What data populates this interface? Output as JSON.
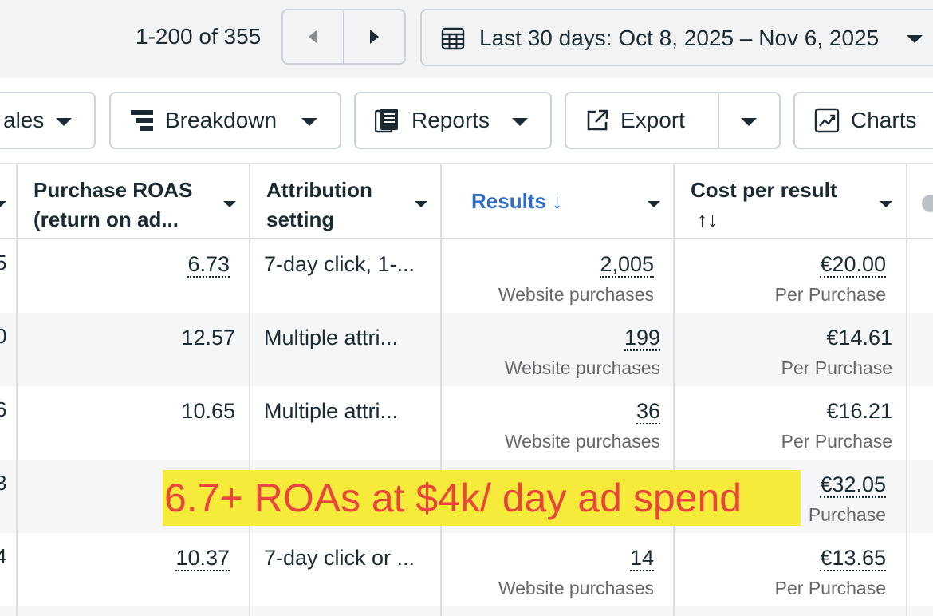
{
  "pagination": {
    "label": "1-200 of 355"
  },
  "date_range": {
    "label": "Last 30 days: Oct 8, 2025 – Nov 6, 2025"
  },
  "toolbar": {
    "sales_label": "ales",
    "breakdown_label": "Breakdown",
    "reports_label": "Reports",
    "export_label": "Export",
    "charts_label": "Charts"
  },
  "table": {
    "headers": {
      "roas": [
        "Purchase ROAS",
        "(return on ad..."
      ],
      "attribution": [
        "Attribution",
        "setting"
      ],
      "results": "Results ↓",
      "cost": [
        "Cost per result",
        "↑↓"
      ]
    },
    "rows": [
      {
        "edge": "5",
        "roas": "6.73",
        "attribution": "7-day click, 1-...",
        "results": "2,005",
        "results_sub": "Website purchases",
        "cost": "€20.00",
        "cost_sub": "Per Purchase"
      },
      {
        "edge": "0",
        "roas": "12.57",
        "attribution": "Multiple attri...",
        "results": "199",
        "results_sub": "Website purchases",
        "cost": "€14.61",
        "cost_sub": "Per Purchase"
      },
      {
        "edge": "6",
        "roas": "10.65",
        "attribution": "Multiple attri...",
        "results": "36",
        "results_sub": "Website purchases",
        "cost": "€16.21",
        "cost_sub": "Per Purchase"
      },
      {
        "edge": "3",
        "roas": "",
        "attribution": "",
        "results": "",
        "results_sub": "",
        "cost": "€32.05",
        "cost_sub": "Purchase"
      },
      {
        "edge": "4",
        "roas": "10.37",
        "attribution": "7-day click or ...",
        "results": "14",
        "results_sub": "Website purchases",
        "cost": "€13.65",
        "cost_sub": "Per Purchase"
      }
    ]
  },
  "overlay": {
    "text": "6.7+ ROAs at $4k/ day ad spend"
  },
  "colors": {
    "accent_blue": "#2d6fc4",
    "highlight_yellow": "#f6ea3b",
    "overlay_red": "#e8453c"
  }
}
